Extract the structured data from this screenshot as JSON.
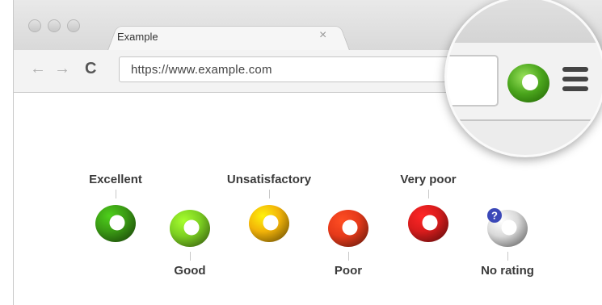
{
  "browser": {
    "tab_title": "Example",
    "tab_close": "×",
    "url": "https://www.example.com",
    "nav_back": "←",
    "nav_forward": "→",
    "nav_reload": "C"
  },
  "colors": {
    "excellent": "#3a9a14",
    "good": "#7ccf22",
    "unsatisfactory": "#f2b308",
    "poor": "#e63a1a",
    "very_poor": "#d81c1c",
    "no_rating": "#d9d9d9"
  },
  "ratings": [
    {
      "label": "Excellent",
      "position": "top",
      "color_key": "excellent"
    },
    {
      "label": "Good",
      "position": "bottom",
      "color_key": "good"
    },
    {
      "label": "Unsatisfactory",
      "position": "top",
      "color_key": "unsatisfactory"
    },
    {
      "label": "Poor",
      "position": "bottom",
      "color_key": "poor"
    },
    {
      "label": "Very poor",
      "position": "top",
      "color_key": "very_poor"
    },
    {
      "label": "No rating",
      "position": "bottom",
      "color_key": "no_rating"
    }
  ],
  "no_rating_badge": "?",
  "icons": [
    "back-arrow-icon",
    "forward-arrow-icon",
    "reload-icon",
    "close-icon",
    "extension-ring-icon",
    "menu-icon",
    "question-badge-icon"
  ]
}
